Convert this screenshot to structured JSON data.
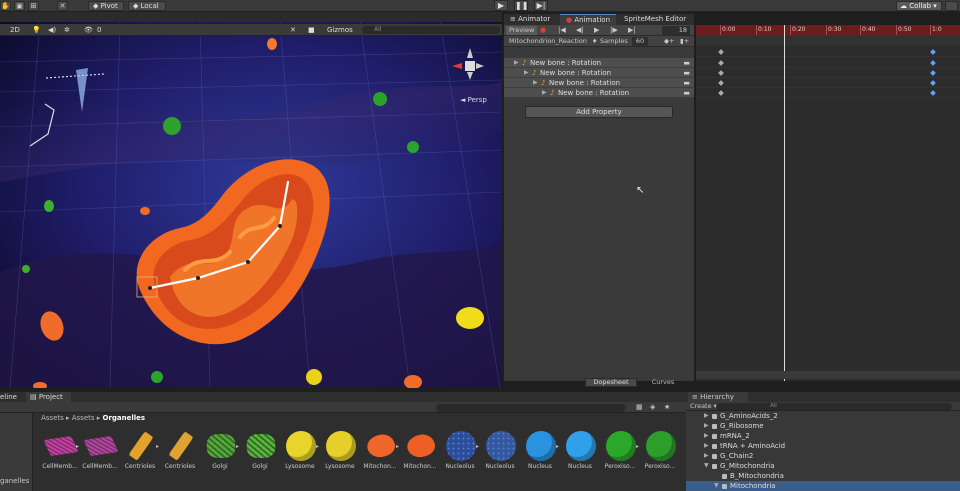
{
  "toolbar": {
    "pivot": "Pivot",
    "local": "Local",
    "collab": "Collab"
  },
  "scene": {
    "mode_2d": "2D",
    "gizmo_counter": "0",
    "gizmos_label": "Gizmos",
    "search_placeholder": "All",
    "persp_label": "Persp"
  },
  "animation": {
    "tabs": [
      "Animator",
      "Animation",
      "SpriteMesh Editor"
    ],
    "preview_label": "Preview",
    "frame": "18",
    "clip_name": "Mitochondrion_Reaction",
    "samples_label": "Samples",
    "samples_value": "60",
    "properties": [
      "New bone : Rotation",
      "New bone : Rotation",
      "New bone : Rotation",
      "New bone : Rotation"
    ],
    "add_property": "Add Property",
    "dopesheet": "Dopesheet",
    "curves": "Curves"
  },
  "timeline": {
    "ticks": [
      "0:00",
      "0:10",
      "0:20",
      "0:30",
      "0:40",
      "0:50",
      "1:0"
    ]
  },
  "bottom": {
    "timeline_tab": "eline",
    "project_tab": "Project",
    "search_placeholder": "",
    "breadcrumb": [
      "Assets",
      "Assets",
      "Organelles"
    ],
    "left_label": "ganelles",
    "assets": [
      {
        "label": "CellMemb...",
        "color": "#c83f9c"
      },
      {
        "label": "CellMemb...",
        "color": "#b04898"
      },
      {
        "label": "Centrioles",
        "color": "#e2a22c"
      },
      {
        "label": "Centrioles",
        "color": "#e0a233"
      },
      {
        "label": "Golgi",
        "color": "#57a83a"
      },
      {
        "label": "Golgi",
        "color": "#5cb33e"
      },
      {
        "label": "Lysosome",
        "color": "#e7d52b"
      },
      {
        "label": "Lysosome",
        "color": "#e5cf28"
      },
      {
        "label": "Mitochon...",
        "color": "#f0662a"
      },
      {
        "label": "Mitochon...",
        "color": "#ee5f25"
      },
      {
        "label": "Nucleolus",
        "color": "#2c4e9a"
      },
      {
        "label": "Nucleolus",
        "color": "#34589e"
      },
      {
        "label": "Nucleus",
        "color": "#2a93e0"
      },
      {
        "label": "Nucleus",
        "color": "#30a0ea"
      },
      {
        "label": "Peroxiso...",
        "color": "#2aa82a"
      },
      {
        "label": "Peroxiso...",
        "color": "#2b9e2c"
      }
    ]
  },
  "hierarchy": {
    "tab": "Hierarchy",
    "create": "Create",
    "search_placeholder": "All",
    "rows": [
      {
        "label": "G_AminoAcids_2",
        "indent": 1,
        "arrow": "▶",
        "selected": false
      },
      {
        "label": "G_Ribosome",
        "indent": 1,
        "arrow": "▶",
        "selected": false
      },
      {
        "label": "mRNA_2",
        "indent": 1,
        "arrow": "▶",
        "selected": false
      },
      {
        "label": "tRNA + AminoAcid",
        "indent": 1,
        "arrow": "▶",
        "selected": false
      },
      {
        "label": "G_Chain2",
        "indent": 1,
        "arrow": "▶",
        "selected": false
      },
      {
        "label": "G_Mitochondria",
        "indent": 1,
        "arrow": "▼",
        "selected": false
      },
      {
        "label": "B_Mitochondria",
        "indent": 2,
        "arrow": "",
        "selected": false
      },
      {
        "label": "Mitochondria",
        "indent": 2,
        "arrow": "▼",
        "selected": true
      }
    ]
  },
  "colors": {
    "timeline_ruler": "#6b1c1c",
    "keyframe_end": "#5da3ff",
    "selection": "#3b5d8c",
    "mitochondrion": "#f0662a"
  }
}
